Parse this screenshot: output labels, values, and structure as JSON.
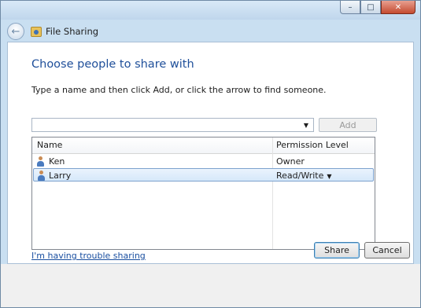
{
  "window": {
    "title": "File Sharing",
    "controls": {
      "minimize": "–",
      "maximize": "□",
      "close": "✕"
    }
  },
  "main": {
    "heading": "Choose people to share with",
    "instruction": "Type a name and then click Add, or click the arrow to find someone.",
    "name_input": {
      "value": "",
      "placeholder": ""
    },
    "add_label": "Add"
  },
  "table": {
    "columns": [
      "Name",
      "Permission Level"
    ],
    "rows": [
      {
        "name": "Ken",
        "permission": "Owner",
        "selected": false
      },
      {
        "name": "Larry",
        "permission": "Read/Write",
        "selected": true
      }
    ]
  },
  "trouble_link": "I'm having trouble sharing",
  "buttons": {
    "share": "Share",
    "cancel": "Cancel"
  },
  "icons": {
    "back": "back-arrow-icon",
    "app": "file-sharing-icon",
    "user": "user-icon",
    "dropdown": "chevron-down-icon"
  },
  "colors": {
    "heading": "#1f4f9a",
    "link": "#1a4fa0",
    "selection": "#d6e8fa",
    "chrome": "#c9dff1"
  }
}
